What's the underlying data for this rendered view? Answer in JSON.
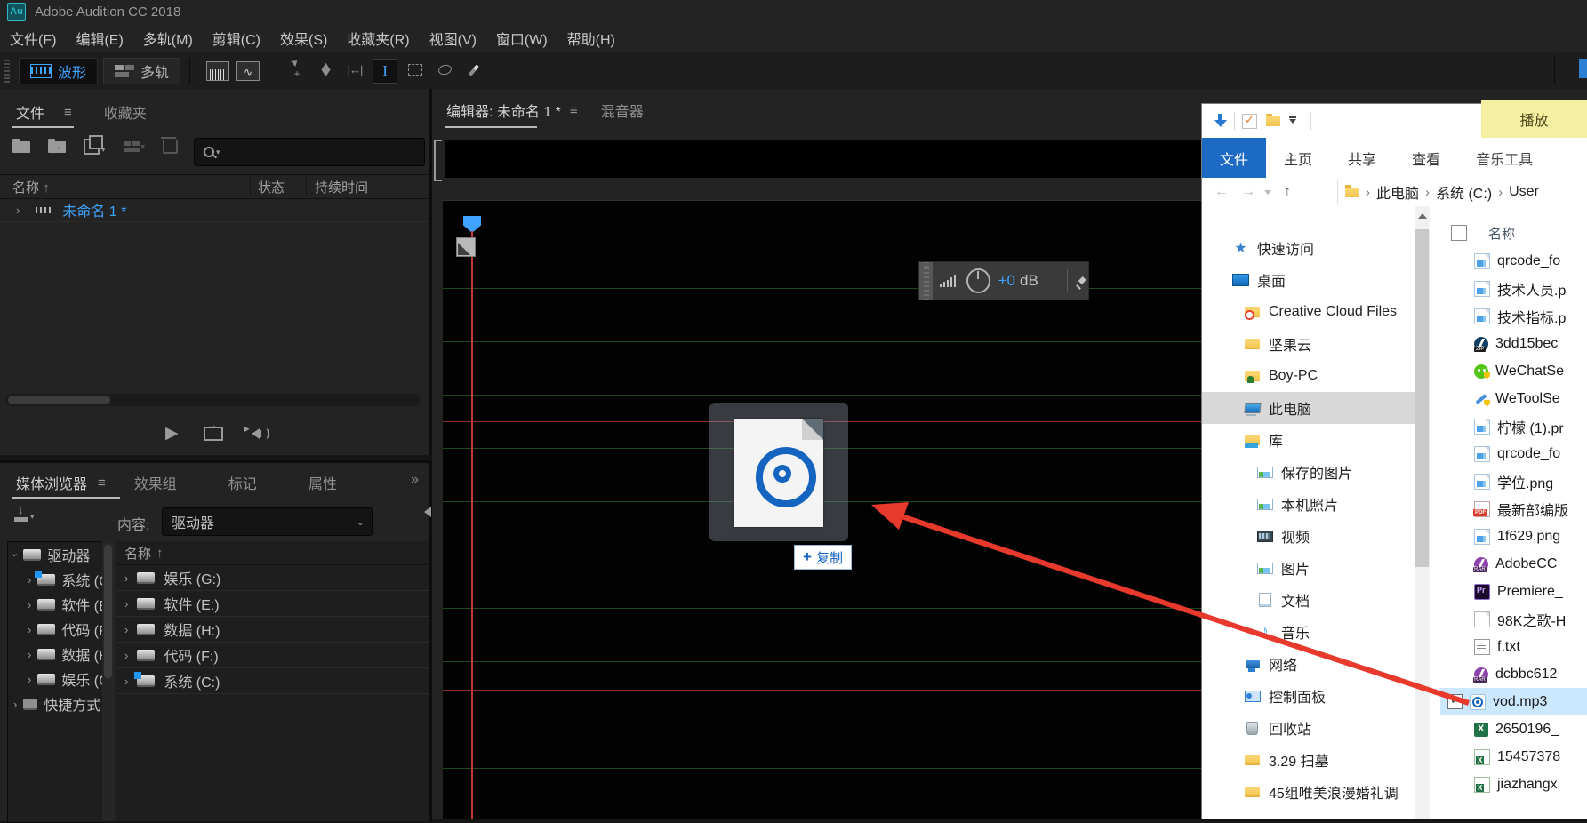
{
  "app": {
    "logo_text": "Au",
    "title": "Adobe Audition CC 2018",
    "menus": [
      {
        "label": "文件(F)"
      },
      {
        "label": "编辑(E)"
      },
      {
        "label": "多轨(M)"
      },
      {
        "label": "剪辑(C)"
      },
      {
        "label": "效果(S)"
      },
      {
        "label": "收藏夹(R)"
      },
      {
        "label": "视图(V)"
      },
      {
        "label": "窗口(W)"
      },
      {
        "label": "帮助(H)"
      }
    ],
    "view_toggle": {
      "waveform": "波形",
      "multitrack": "多轨"
    },
    "tools": [
      {
        "name": "move"
      },
      {
        "name": "razor"
      },
      {
        "name": "slip"
      },
      {
        "name": "ibeam",
        "active": true
      },
      {
        "name": "marquee"
      },
      {
        "name": "lasso"
      },
      {
        "name": "brush"
      }
    ]
  },
  "files_panel": {
    "tab_files": "文件",
    "tab_favorites": "收藏夹",
    "col_name": "名称",
    "sort_arrow": "↑",
    "col_status": "状态",
    "col_duration": "持续时间",
    "items": [
      {
        "label": "未命名 1 *"
      }
    ]
  },
  "media_panel": {
    "tab_media": "媒体浏览器",
    "tab_effects": "效果组",
    "tab_markers": "标记",
    "tab_props": "属性",
    "overflow_glyph": "»",
    "content_label": "内容:",
    "content_value": "驱动器",
    "tree_root": "驱动器",
    "tree_shortcut": "快捷方式",
    "col_name": "名称",
    "sort_arrow": "↑",
    "drives": [
      {
        "label": "娱乐 (G:)"
      },
      {
        "label": "软件 (E:)"
      },
      {
        "label": "数据 (H:)"
      },
      {
        "label": "代码 (F:)"
      },
      {
        "label": "系统 (C:)",
        "badge": true
      }
    ],
    "tree_drives": [
      {
        "label": "系统 (C:)",
        "badge": true
      },
      {
        "label": "软件 (E:)"
      },
      {
        "label": "代码 (F:)"
      },
      {
        "label": "数据 (H:)"
      },
      {
        "label": "娱乐 (G:)"
      }
    ]
  },
  "editor": {
    "tab_editor": "编辑器: 未命名 1 *",
    "tab_mixer": "混音器",
    "hud_value": "+0",
    "hud_unit": "dB"
  },
  "drag": {
    "copy_plus": "+",
    "copy_label": "复制"
  },
  "explorer": {
    "contextual_header": "播放",
    "ribbon_tabs": [
      {
        "label": "文件",
        "active": true
      },
      {
        "label": "主页"
      },
      {
        "label": "共享"
      },
      {
        "label": "查看"
      },
      {
        "label": "音乐工具",
        "contextual": true
      }
    ],
    "breadcrumb": [
      {
        "label": "此电脑"
      },
      {
        "label": "系统 (C:)"
      },
      {
        "label": "User"
      }
    ],
    "sidebar": [
      {
        "label": "快速访问",
        "type": "star",
        "indent": 0
      },
      {
        "label": "桌面",
        "type": "desktop",
        "indent": 0
      },
      {
        "label": "Creative Cloud Files",
        "type": "ccfolder",
        "indent": 1
      },
      {
        "label": "坚果云",
        "type": "folder",
        "indent": 1
      },
      {
        "label": "Boy-PC",
        "type": "userfolder",
        "indent": 1
      },
      {
        "label": "此电脑",
        "type": "pc",
        "indent": 1,
        "sel": true
      },
      {
        "label": "库",
        "type": "lib",
        "indent": 1
      },
      {
        "label": "保存的图片",
        "type": "pic",
        "indent": 2
      },
      {
        "label": "本机照片",
        "type": "pic",
        "indent": 2
      },
      {
        "label": "视频",
        "type": "video",
        "indent": 2
      },
      {
        "label": "图片",
        "type": "pic",
        "indent": 2
      },
      {
        "label": "文档",
        "type": "doc",
        "indent": 2
      },
      {
        "label": "音乐",
        "type": "music",
        "indent": 2
      },
      {
        "label": "网络",
        "type": "net",
        "indent": 1
      },
      {
        "label": "控制面板",
        "type": "cpanel",
        "indent": 1
      },
      {
        "label": "回收站",
        "type": "recycle",
        "indent": 1
      },
      {
        "label": "3.29 扫墓",
        "type": "folder",
        "indent": 1
      },
      {
        "label": "45组唯美浪漫婚礼调",
        "type": "folder",
        "indent": 1
      }
    ],
    "list_header": "名称",
    "files": [
      {
        "label": "qrcode_fo",
        "type": "img"
      },
      {
        "label": "技术人员.p",
        "type": "img"
      },
      {
        "label": "技术指标.p",
        "type": "img"
      },
      {
        "label": "3dd15bec",
        "type": "zip"
      },
      {
        "label": "WeChatSe",
        "type": "wechat"
      },
      {
        "label": "WeToolSe",
        "type": "wrench"
      },
      {
        "label": "柠檬 (1).pr",
        "type": "img"
      },
      {
        "label": "qrcode_fo",
        "type": "img"
      },
      {
        "label": "学位.png",
        "type": "img"
      },
      {
        "label": "最新部编版",
        "type": "pdf"
      },
      {
        "label": "1f629.png",
        "type": "img"
      },
      {
        "label": "AdobeCC",
        "type": "rar"
      },
      {
        "label": "Premiere_",
        "type": "pr"
      },
      {
        "label": "98K之歌-H",
        "type": "blank"
      },
      {
        "label": "f.txt",
        "type": "txt"
      },
      {
        "label": "dcbbc612",
        "type": "rar"
      },
      {
        "label": "vod.mp3",
        "type": "mp3",
        "sel": true
      },
      {
        "label": "2650196_",
        "type": "xls"
      },
      {
        "label": "15457378",
        "type": "xls2"
      },
      {
        "label": "jiazhangx",
        "type": "xls2"
      }
    ]
  }
}
